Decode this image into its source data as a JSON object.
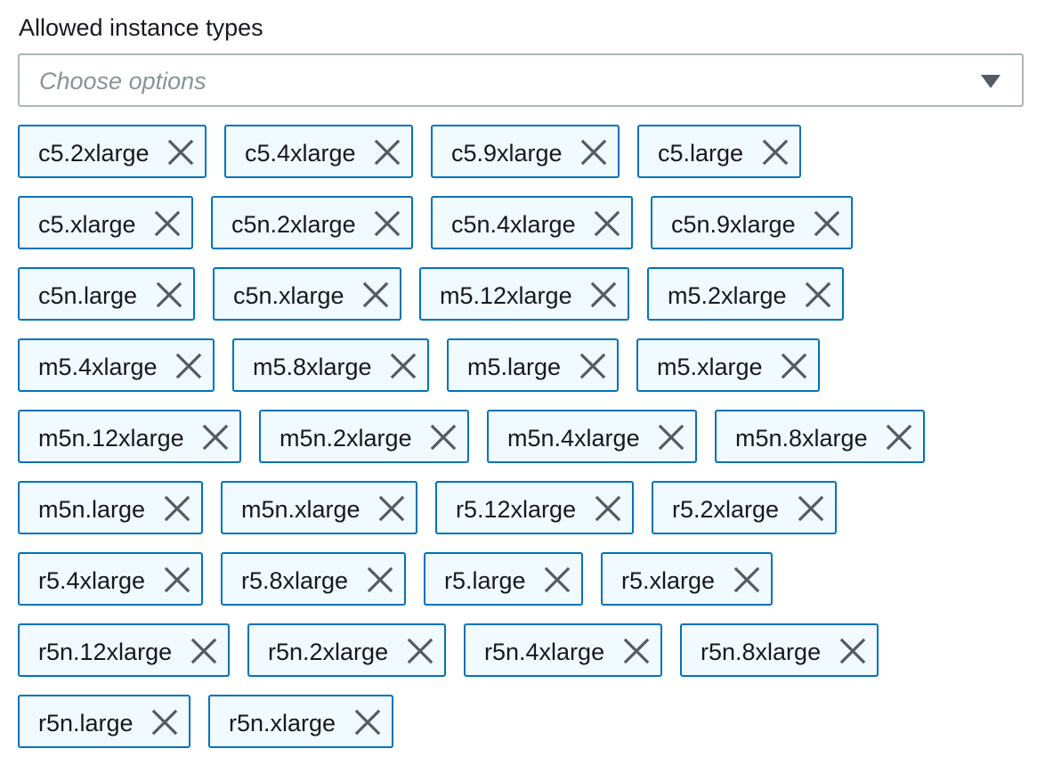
{
  "field": {
    "label": "Allowed instance types",
    "placeholder": "Choose options"
  },
  "icons": {
    "dropdown": "caret-down-icon",
    "remove": "close-icon"
  },
  "colors": {
    "token_border": "#0073bb",
    "token_background": "#f1faff",
    "select_border": "#aab7b8",
    "placeholder_text": "#879596",
    "icon": "#545b64"
  },
  "tokens": [
    [
      "c5.2xlarge",
      "c5.4xlarge",
      "c5.9xlarge",
      "c5.large"
    ],
    [
      "c5.xlarge",
      "c5n.2xlarge",
      "c5n.4xlarge",
      "c5n.9xlarge"
    ],
    [
      "c5n.large",
      "c5n.xlarge",
      "m5.12xlarge",
      "m5.2xlarge"
    ],
    [
      "m5.4xlarge",
      "m5.8xlarge",
      "m5.large",
      "m5.xlarge"
    ],
    [
      "m5n.12xlarge",
      "m5n.2xlarge",
      "m5n.4xlarge",
      "m5n.8xlarge"
    ],
    [
      "m5n.large",
      "m5n.xlarge",
      "r5.12xlarge",
      "r5.2xlarge"
    ],
    [
      "r5.4xlarge",
      "r5.8xlarge",
      "r5.large",
      "r5.xlarge"
    ],
    [
      "r5n.12xlarge",
      "r5n.2xlarge",
      "r5n.4xlarge",
      "r5n.8xlarge"
    ],
    [
      "r5n.large",
      "r5n.xlarge"
    ]
  ]
}
